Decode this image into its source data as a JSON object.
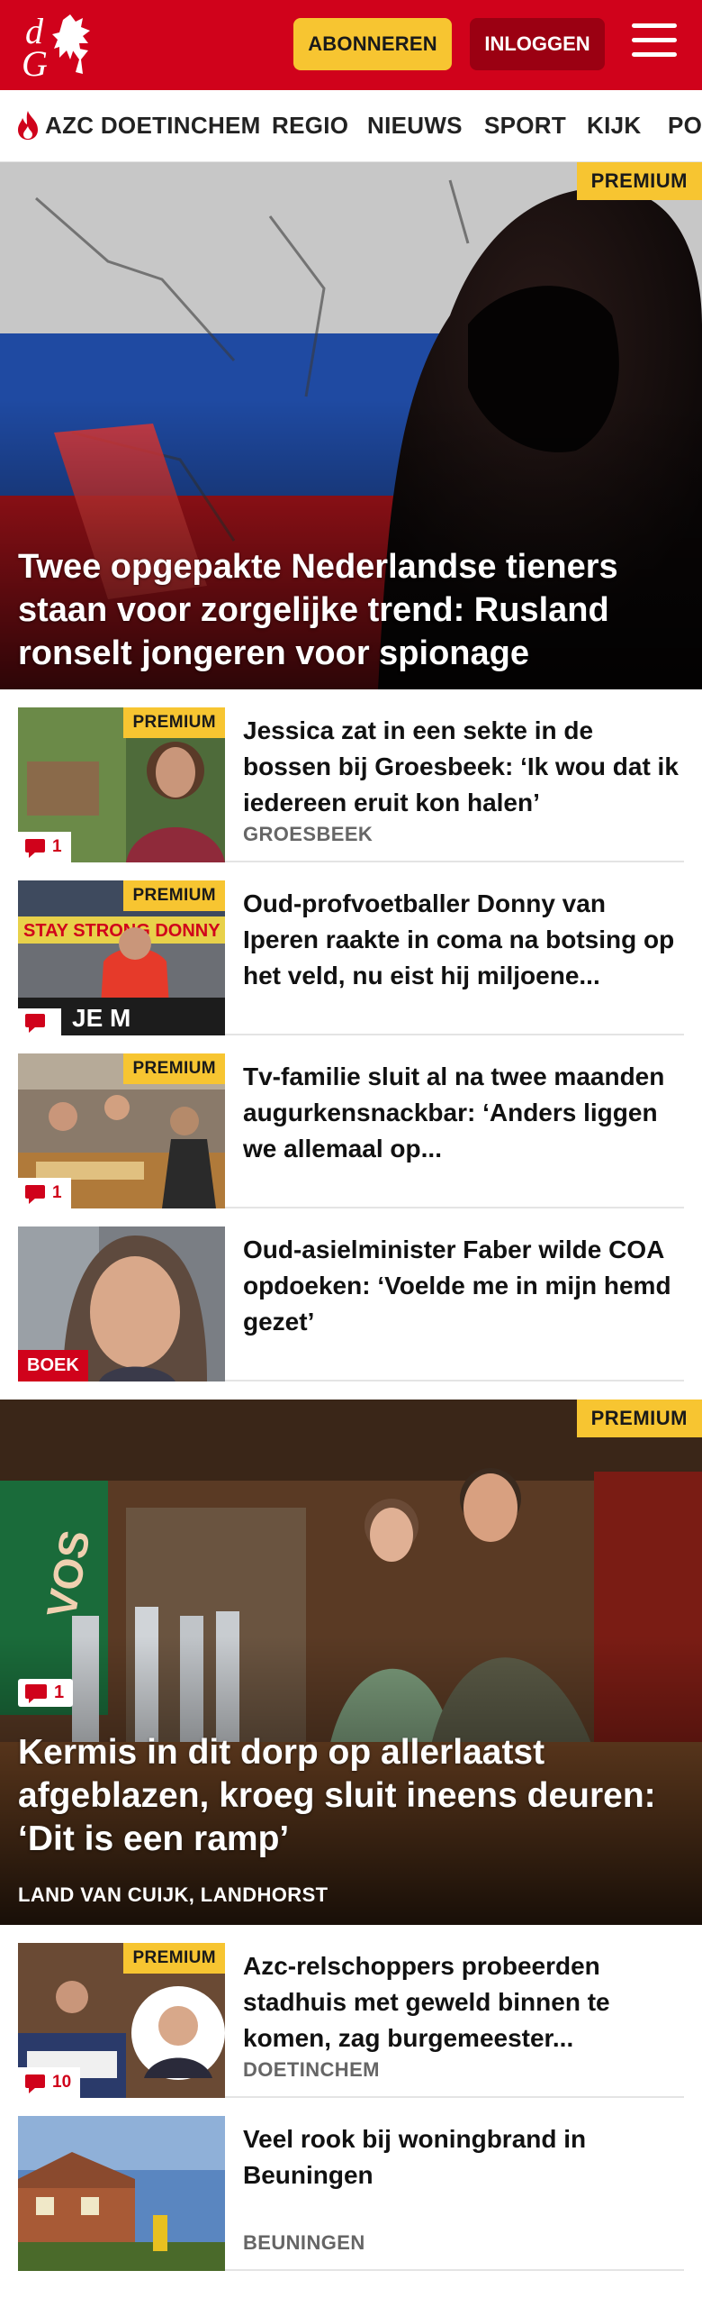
{
  "header": {
    "subscribe_label": "ABONNEREN",
    "login_label": "INLOGGEN",
    "brand_color": "#d0021b",
    "accent_color": "#f7c531"
  },
  "nav": {
    "items": [
      "AZC DOETINCHEM",
      "REGIO",
      "NIEUWS",
      "SPORT",
      "KIJK",
      "PO"
    ]
  },
  "hero": {
    "premium": "PREMIUM",
    "title": "Twee opgepakte Nederlandse tieners staan voor zorgelijke trend: Rusland ronselt jongeren voor spionage"
  },
  "articles": [
    {
      "premium": "PREMIUM",
      "comments": "1",
      "title": "Jessica zat in een sekte in de bossen bij Groesbeek: ‘Ik wou dat ik iedereen eruit kon halen’",
      "location": "GROESBEEK"
    },
    {
      "premium": "PREMIUM",
      "comments": "",
      "title": "Oud-profvoetballer Donny van Iperen raakte in coma na botsing op het veld, nu eist hij miljoene...",
      "location": ""
    },
    {
      "premium": "PREMIUM",
      "comments": "1",
      "title": "Tv-familie sluit al na twee maanden augurkensnackbar: ‘Anders liggen we allemaal op...",
      "location": ""
    },
    {
      "label": "BOEK",
      "title": "Oud-asielminister Faber wilde COA opdoeken: ‘Voelde me in mijn hemd gezet’",
      "location": ""
    }
  ],
  "feature": {
    "premium": "PREMIUM",
    "comments": "1",
    "title": "Kermis in dit dorp op allerlaatst afgeblazen, kroeg sluit ineens deuren: ‘Dit is een ramp’",
    "location": "LAND VAN CUIJK, LANDHORST"
  },
  "articles2": [
    {
      "premium": "PREMIUM",
      "comments": "10",
      "title": "Azc-relschoppers probeerden stadhuis met geweld binnen te komen, zag burgemeester...",
      "location": "DOETINCHEM"
    },
    {
      "title": "Veel rook bij woningbrand in Beuningen",
      "location": "BEUNINGEN"
    }
  ]
}
